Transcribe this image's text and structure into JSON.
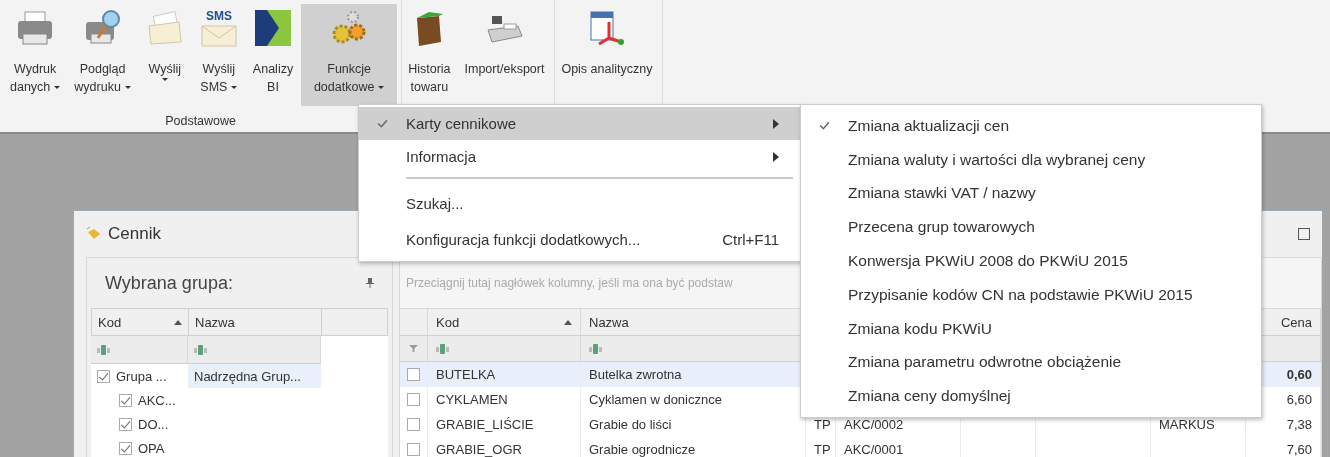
{
  "ribbon": {
    "groups": [
      {
        "label": "Podstawowe",
        "buttons": [
          {
            "kind": "printer",
            "lines": [
              "Wydruk",
              "danych"
            ],
            "dropdown": true,
            "selected": false
          },
          {
            "kind": "preview",
            "lines": [
              "Podgląd",
              "wydruku"
            ],
            "dropdown": true,
            "selected": false
          },
          {
            "kind": "send",
            "lines": [
              "Wyślij"
            ],
            "dropdown": true,
            "selected": false
          },
          {
            "kind": "sms",
            "icon_text": "SMS",
            "lines": [
              "Wyślij",
              "SMS"
            ],
            "dropdown": true,
            "selected": false
          },
          {
            "kind": "bi",
            "lines": [
              "Analizy",
              "BI"
            ],
            "dropdown": false,
            "selected": false
          },
          {
            "kind": "gears",
            "lines": [
              "Funkcje",
              "dodatkowe"
            ],
            "dropdown": true,
            "selected": true
          }
        ]
      },
      {
        "buttons": [
          {
            "kind": "crate",
            "lines": [
              "Historia",
              "towaru"
            ],
            "dropdown": false,
            "selected": false
          },
          {
            "kind": "register",
            "lines": [
              "Import/eksport"
            ],
            "dropdown": false,
            "selected": false
          }
        ]
      },
      {
        "buttons": [
          {
            "kind": "analytics",
            "lines": [
              "Opis analityczny"
            ],
            "dropdown": false,
            "selected": false
          }
        ]
      }
    ]
  },
  "window": {
    "title": "Cennik",
    "left_panel": {
      "title": "Wybrana grupa:",
      "columns": [
        {
          "label": "Kod",
          "sorted": true
        },
        {
          "label": "Nazwa",
          "sorted": false
        }
      ],
      "tree": [
        {
          "kod": "Grupa ...",
          "nazwa": "Nadrzędna Grup...",
          "checked": true,
          "selected": true,
          "children": [
            {
              "kod": "AKC...",
              "checked": true,
              "selected": false
            },
            {
              "kod": "DO...",
              "checked": true,
              "selected": false
            },
            {
              "kod": "OPA",
              "checked": true,
              "selected": false
            }
          ]
        }
      ]
    },
    "grid": {
      "group_hint": "Przeciągnij tutaj nagłówek kolumny, jeśli ma ona być podstaw",
      "columns": [
        {
          "label": "Kod",
          "sorted": true
        },
        {
          "label": "Nazwa",
          "sorted": false
        },
        {
          "label": "Cena",
          "sorted": false
        }
      ],
      "rows": [
        {
          "checked": false,
          "selected": true,
          "kod": "BUTELKA",
          "nazwa": "Butelka zwrotna",
          "cena": "0,60"
        },
        {
          "checked": false,
          "selected": false,
          "kod": "CYKLAMEN",
          "nazwa": "Cyklamen w donicznce",
          "cena": "6,60"
        },
        {
          "checked": false,
          "selected": false,
          "kod": "GRABIE_LIŚCIE",
          "nazwa": "Grabie do liści",
          "column_3": "TP",
          "column_4": "AKC/0002",
          "column_7": "MARKUS",
          "cena": "7,38"
        },
        {
          "checked": false,
          "selected": false,
          "kod": "GRABIE_OGR",
          "nazwa": "Grabie ogrodnicze",
          "column_3": "TP",
          "column_4": "AKC/0001",
          "cena": "7,60"
        }
      ]
    }
  },
  "menu": {
    "items": [
      {
        "kind": "item",
        "label": "Karty cennikowe",
        "checked": true,
        "submenu": true,
        "selected": true
      },
      {
        "kind": "item",
        "label": "Informacja",
        "checked": false,
        "submenu": true,
        "selected": false
      },
      {
        "kind": "separator"
      },
      {
        "kind": "item",
        "label": "Szukaj...",
        "checked": false,
        "submenu": false,
        "selected": false
      },
      {
        "kind": "item",
        "label": "Konfiguracja funkcji dodatkowych...",
        "shortcut": "Ctrl+F11",
        "checked": false,
        "submenu": false,
        "selected": false
      }
    ]
  },
  "submenu": {
    "items": [
      {
        "label": "Zmiana aktualizacji cen",
        "checked": true
      },
      {
        "label": "Zmiana waluty i wartości dla wybranej ceny",
        "checked": false
      },
      {
        "label": "Zmiana stawki VAT / nazwy",
        "checked": false
      },
      {
        "label": "Przecena grup towarowych",
        "checked": false
      },
      {
        "label": "Konwersja PKWiU 2008 do PKWiU 2015",
        "checked": false
      },
      {
        "label": "Przypisanie kodów CN na podstawie PKWiU 2015",
        "checked": false
      },
      {
        "label": "Zmiana kodu PKWiU",
        "checked": false
      },
      {
        "label": "Zmiana parametru odwrotne obciążenie",
        "checked": false
      },
      {
        "label": "Zmiana ceny domyślnej",
        "checked": false
      }
    ]
  }
}
